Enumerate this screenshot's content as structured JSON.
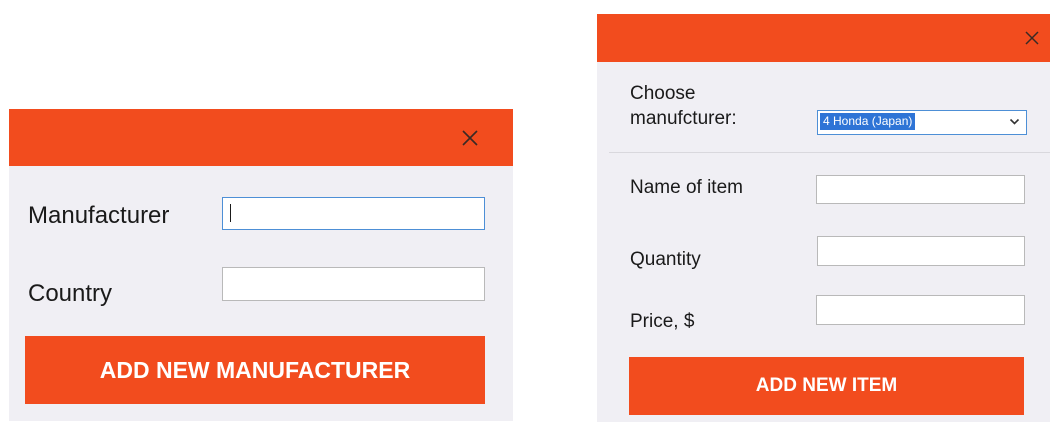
{
  "manufacturer_dialog": {
    "close_glyph": "✕",
    "manufacturer_label": "Manufacturer",
    "manufacturer_value": "",
    "country_label": "Country",
    "country_value": "",
    "add_button_label": "ADD NEW MANUFACTURER"
  },
  "item_dialog": {
    "close_glyph": "✕",
    "choose_label_line1": "Choose",
    "choose_label_line2": "manufcturer:",
    "selected_manufacturer": "4 Honda (Japan)",
    "name_label": "Name of item",
    "name_value": "",
    "quantity_label": "Quantity",
    "quantity_value": "",
    "price_label": "Price, $",
    "price_value": "",
    "add_button_label": "ADD NEW ITEM"
  },
  "colors": {
    "accent": "#f24c1e",
    "dialog_background": "#f0eff4",
    "focus_border": "#4d8fd6",
    "selection": "#2e74d6"
  },
  "icons": {
    "close": "close-icon",
    "dropdown": "chevron-down-icon"
  }
}
